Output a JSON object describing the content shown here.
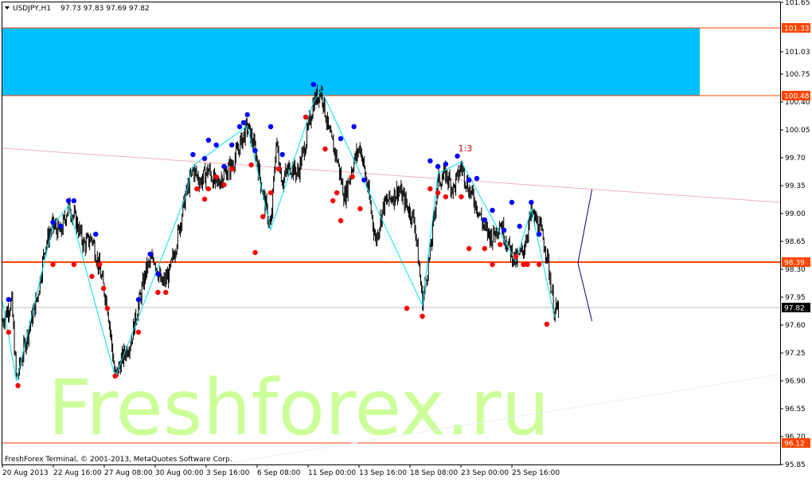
{
  "header": {
    "symbol": "USDJPY,H1",
    "ohlc": "97.73 97.83 97.69 97.82",
    "menu_arrow": "triangle-down-icon"
  },
  "watermark": "Freshforex.ru",
  "copyright": "FreshForex Terminal, © 2001-2013, MetaQuotes Software Corp.",
  "colors": {
    "background": "#ffffff",
    "candles": "#000000",
    "zone": "#00bfff",
    "support_line": "#ff4500",
    "trend_pink": "#f0b0c0",
    "zigzag": "#00e0f0",
    "fractal_up": "#0000ff",
    "fractal_down": "#ff0000",
    "projection": "#000080",
    "current_price_line": "#c0c0c0",
    "watermark": "#ccff99"
  },
  "chart_data": {
    "type": "candlestick",
    "symbol": "USDJPY",
    "timeframe": "H1",
    "ylim": [
      95.85,
      101.65
    ],
    "y_ticks": [
      "101.65",
      "101.33",
      "101.03",
      "100.75",
      "100.48",
      "100.40",
      "100.05",
      "99.70",
      "99.35",
      "99.00",
      "98.65",
      "98.39",
      "98.30",
      "97.95",
      "97.82",
      "97.60",
      "97.25",
      "96.90",
      "96.55",
      "96.20",
      "96.12",
      "95.85"
    ],
    "y_tick_values": [
      101.65,
      101.03,
      100.75,
      100.4,
      100.05,
      99.7,
      99.35,
      99.0,
      98.65,
      98.3,
      97.95,
      97.6,
      97.25,
      96.9,
      96.55,
      96.2,
      95.85
    ],
    "x_ticks": [
      "20 Aug 2013",
      "22 Aug 16:00",
      "27 Aug 08:00",
      "30 Aug 00:00",
      "3 Sep 16:00",
      "6 Sep 08:00",
      "11 Sep 00:00",
      "13 Sep 16:00",
      "18 Sep 08:00",
      "23 Sep 00:00",
      "25 Sep 16:00"
    ],
    "price_tags": [
      {
        "label": "101.33",
        "value": 101.33,
        "color": "#ff4500"
      },
      {
        "label": "100.48",
        "value": 100.48,
        "color": "#ff4500"
      },
      {
        "label": "98.39",
        "value": 98.39,
        "color": "#ff4500"
      },
      {
        "label": "97.82",
        "value": 97.82,
        "color": "#000000"
      },
      {
        "label": "96.12",
        "value": 96.12,
        "color": "#ff4500"
      }
    ],
    "zone": {
      "top": 101.33,
      "bottom": 100.48
    },
    "horizontal_lines": [
      {
        "value": 101.33,
        "style": "thin",
        "color": "#ff4500"
      },
      {
        "value": 100.48,
        "style": "thin",
        "color": "#ff4500"
      },
      {
        "value": 98.39,
        "style": "thick",
        "color": "#ff4500"
      },
      {
        "value": 97.82,
        "style": "thin",
        "color": "#c0c0c0"
      },
      {
        "value": 96.12,
        "style": "thin",
        "color": "#ff4500"
      }
    ],
    "trend_lines": [
      {
        "x0": 0.0,
        "y0": 99.82,
        "x1": 1.0,
        "y1": 99.14,
        "color": "#f0b0c0"
      },
      {
        "x0": 0.28,
        "y0": 95.85,
        "x1": 1.0,
        "y1": 96.98,
        "color": "#e8eef4"
      }
    ],
    "annotation": {
      "text": "1:3",
      "x": 0.586,
      "y": 99.78,
      "color": "#cc0000"
    },
    "path": [
      [
        0.0,
        97.65
      ],
      [
        0.012,
        97.9
      ],
      [
        0.018,
        96.9
      ],
      [
        0.03,
        97.4
      ],
      [
        0.045,
        97.95
      ],
      [
        0.055,
        98.6
      ],
      [
        0.065,
        98.85
      ],
      [
        0.075,
        98.75
      ],
      [
        0.085,
        99.1
      ],
      [
        0.095,
        98.9
      ],
      [
        0.105,
        98.6
      ],
      [
        0.115,
        98.7
      ],
      [
        0.125,
        98.3
      ],
      [
        0.135,
        97.85
      ],
      [
        0.145,
        96.95
      ],
      [
        0.155,
        97.2
      ],
      [
        0.165,
        97.4
      ],
      [
        0.175,
        97.85
      ],
      [
        0.185,
        98.3
      ],
      [
        0.195,
        98.45
      ],
      [
        0.205,
        98.1
      ],
      [
        0.215,
        98.25
      ],
      [
        0.225,
        98.7
      ],
      [
        0.235,
        99.2
      ],
      [
        0.245,
        99.55
      ],
      [
        0.255,
        99.4
      ],
      [
        0.265,
        99.55
      ],
      [
        0.275,
        99.35
      ],
      [
        0.285,
        99.5
      ],
      [
        0.295,
        99.6
      ],
      [
        0.305,
        99.85
      ],
      [
        0.315,
        100.1
      ],
      [
        0.325,
        99.8
      ],
      [
        0.335,
        99.25
      ],
      [
        0.345,
        98.8
      ],
      [
        0.352,
        99.9
      ],
      [
        0.36,
        99.4
      ],
      [
        0.37,
        99.6
      ],
      [
        0.38,
        99.5
      ],
      [
        0.39,
        99.9
      ],
      [
        0.4,
        100.4
      ],
      [
        0.41,
        100.55
      ],
      [
        0.42,
        100.0
      ],
      [
        0.43,
        99.7
      ],
      [
        0.44,
        99.2
      ],
      [
        0.45,
        99.6
      ],
      [
        0.46,
        99.85
      ],
      [
        0.47,
        99.3
      ],
      [
        0.48,
        98.65
      ],
      [
        0.49,
        99.1
      ],
      [
        0.5,
        99.2
      ],
      [
        0.51,
        99.3
      ],
      [
        0.52,
        99.1
      ],
      [
        0.53,
        98.9
      ],
      [
        0.54,
        97.9
      ],
      [
        0.55,
        98.5
      ],
      [
        0.56,
        99.4
      ],
      [
        0.57,
        99.5
      ],
      [
        0.58,
        99.3
      ],
      [
        0.59,
        99.6
      ],
      [
        0.6,
        99.3
      ],
      [
        0.61,
        99.1
      ],
      [
        0.62,
        98.8
      ],
      [
        0.63,
        98.7
      ],
      [
        0.64,
        98.9
      ],
      [
        0.65,
        98.6
      ],
      [
        0.66,
        98.4
      ],
      [
        0.67,
        98.55
      ],
      [
        0.68,
        99.0
      ],
      [
        0.69,
        98.85
      ],
      [
        0.7,
        98.5
      ],
      [
        0.71,
        97.75
      ],
      [
        0.715,
        97.82
      ]
    ],
    "zigzag": [
      [
        0.0,
        97.9
      ],
      [
        0.018,
        96.9
      ],
      [
        0.065,
        98.85
      ],
      [
        0.085,
        99.1
      ],
      [
        0.145,
        96.95
      ],
      [
        0.235,
        99.2
      ],
      [
        0.245,
        99.6
      ],
      [
        0.315,
        100.1
      ],
      [
        0.345,
        98.8
      ],
      [
        0.4,
        100.4
      ],
      [
        0.41,
        100.55
      ],
      [
        0.47,
        99.3
      ],
      [
        0.54,
        97.85
      ],
      [
        0.56,
        99.5
      ],
      [
        0.59,
        99.65
      ],
      [
        0.66,
        98.4
      ],
      [
        0.68,
        99.05
      ],
      [
        0.71,
        97.7
      ]
    ],
    "fractals_up": [
      [
        0.008,
        97.88
      ],
      [
        0.065,
        98.85
      ],
      [
        0.075,
        98.8
      ],
      [
        0.085,
        99.12
      ],
      [
        0.092,
        99.12
      ],
      [
        0.12,
        98.7
      ],
      [
        0.175,
        97.88
      ],
      [
        0.19,
        98.45
      ],
      [
        0.2,
        98.2
      ],
      [
        0.245,
        99.7
      ],
      [
        0.26,
        99.65
      ],
      [
        0.265,
        99.88
      ],
      [
        0.275,
        99.82
      ],
      [
        0.285,
        99.55
      ],
      [
        0.295,
        99.82
      ],
      [
        0.305,
        100.05
      ],
      [
        0.31,
        100.1
      ],
      [
        0.315,
        100.2
      ],
      [
        0.325,
        99.75
      ],
      [
        0.345,
        100.05
      ],
      [
        0.36,
        99.7
      ],
      [
        0.4,
        100.58
      ],
      [
        0.435,
        99.9
      ],
      [
        0.452,
        100.05
      ],
      [
        0.465,
        99.38
      ],
      [
        0.55,
        99.62
      ],
      [
        0.56,
        99.55
      ],
      [
        0.57,
        99.58
      ],
      [
        0.585,
        99.68
      ],
      [
        0.6,
        99.38
      ],
      [
        0.61,
        99.4
      ],
      [
        0.62,
        98.88
      ],
      [
        0.63,
        99.0
      ],
      [
        0.645,
        98.75
      ],
      [
        0.655,
        99.1
      ],
      [
        0.665,
        98.8
      ],
      [
        0.68,
        99.1
      ],
      [
        0.69,
        98.7
      ]
    ],
    "fractals_down": [
      [
        0.008,
        97.55
      ],
      [
        0.02,
        96.88
      ],
      [
        0.065,
        98.4
      ],
      [
        0.092,
        98.4
      ],
      [
        0.115,
        98.25
      ],
      [
        0.125,
        98.4
      ],
      [
        0.13,
        98.1
      ],
      [
        0.135,
        97.85
      ],
      [
        0.145,
        97.0
      ],
      [
        0.175,
        97.55
      ],
      [
        0.2,
        98.05
      ],
      [
        0.21,
        98.05
      ],
      [
        0.25,
        99.35
      ],
      [
        0.26,
        99.22
      ],
      [
        0.265,
        99.35
      ],
      [
        0.275,
        99.5
      ],
      [
        0.285,
        99.4
      ],
      [
        0.295,
        99.6
      ],
      [
        0.32,
        99.65
      ],
      [
        0.335,
        99.0
      ],
      [
        0.325,
        98.55
      ],
      [
        0.345,
        99.3
      ],
      [
        0.355,
        99.6
      ],
      [
        0.39,
        100.25
      ],
      [
        0.415,
        99.85
      ],
      [
        0.425,
        99.2
      ],
      [
        0.43,
        99.3
      ],
      [
        0.435,
        98.95
      ],
      [
        0.45,
        99.5
      ],
      [
        0.46,
        99.1
      ],
      [
        0.52,
        97.85
      ],
      [
        0.54,
        97.75
      ],
      [
        0.55,
        99.35
      ],
      [
        0.56,
        99.3
      ],
      [
        0.57,
        99.25
      ],
      [
        0.59,
        99.25
      ],
      [
        0.6,
        98.6
      ],
      [
        0.62,
        98.6
      ],
      [
        0.63,
        98.4
      ],
      [
        0.64,
        98.65
      ],
      [
        0.66,
        98.5
      ],
      [
        0.67,
        98.4
      ],
      [
        0.675,
        98.4
      ],
      [
        0.69,
        98.4
      ],
      [
        0.7,
        97.65
      ]
    ],
    "projection": [
      [
        0.74,
        98.38
      ],
      [
        0.758,
        99.3
      ],
      [
        0.74,
        98.38
      ],
      [
        0.758,
        97.65
      ]
    ]
  }
}
